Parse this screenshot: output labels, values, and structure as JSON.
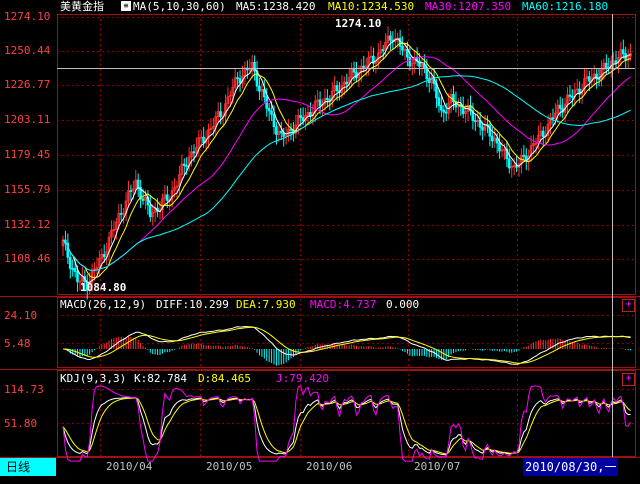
{
  "main_panel": {
    "instrument": "美黄金指",
    "ma_label": "MA(5,10,30,60)",
    "ma5": "MA5:1238.420",
    "ma10": "MA10:1234.530",
    "ma30": "MA30:1207.350",
    "ma60": "MA60:1216.180",
    "y_ticks": [
      "1274.10",
      "1250.44",
      "1226.77",
      "1203.11",
      "1179.45",
      "1155.79",
      "1132.12",
      "1108.46"
    ],
    "high_annotation": "1274.10",
    "low_annotation": "1084.80"
  },
  "macd_panel": {
    "label": "MACD(26,12,9)",
    "diff": "DIFF:10.299",
    "dea": "DEA:7.930",
    "macd": "MACD:4.737",
    "zero": "0.000",
    "y_ticks": [
      "24.10",
      "5.48"
    ]
  },
  "kdj_panel": {
    "label": "KDJ(9,3,3)",
    "k": "K:82.784",
    "d": "D:84.465",
    "j": "J:79.420",
    "y_ticks": [
      "114.73",
      "51.80"
    ]
  },
  "footer": {
    "period_tab": "日线",
    "x_labels": [
      "2010/04",
      "2010/05",
      "2010/06",
      "2010/07"
    ],
    "cursor_date": "2010/08/30,一"
  },
  "colors": {
    "up": "#ff3030",
    "down": "#00ffff",
    "ma5": "#ffffff",
    "ma10": "#ffff00",
    "ma30": "#ff00ff",
    "ma60": "#00ffff",
    "grid": "#8b0000"
  },
  "chart_data": {
    "type": "candlestick",
    "y_range": [
      1084.8,
      1274.1
    ],
    "x_categories_visible": [
      "2010/04",
      "2010/05",
      "2010/06",
      "2010/07"
    ],
    "last_close_approx": 1240.0
  }
}
